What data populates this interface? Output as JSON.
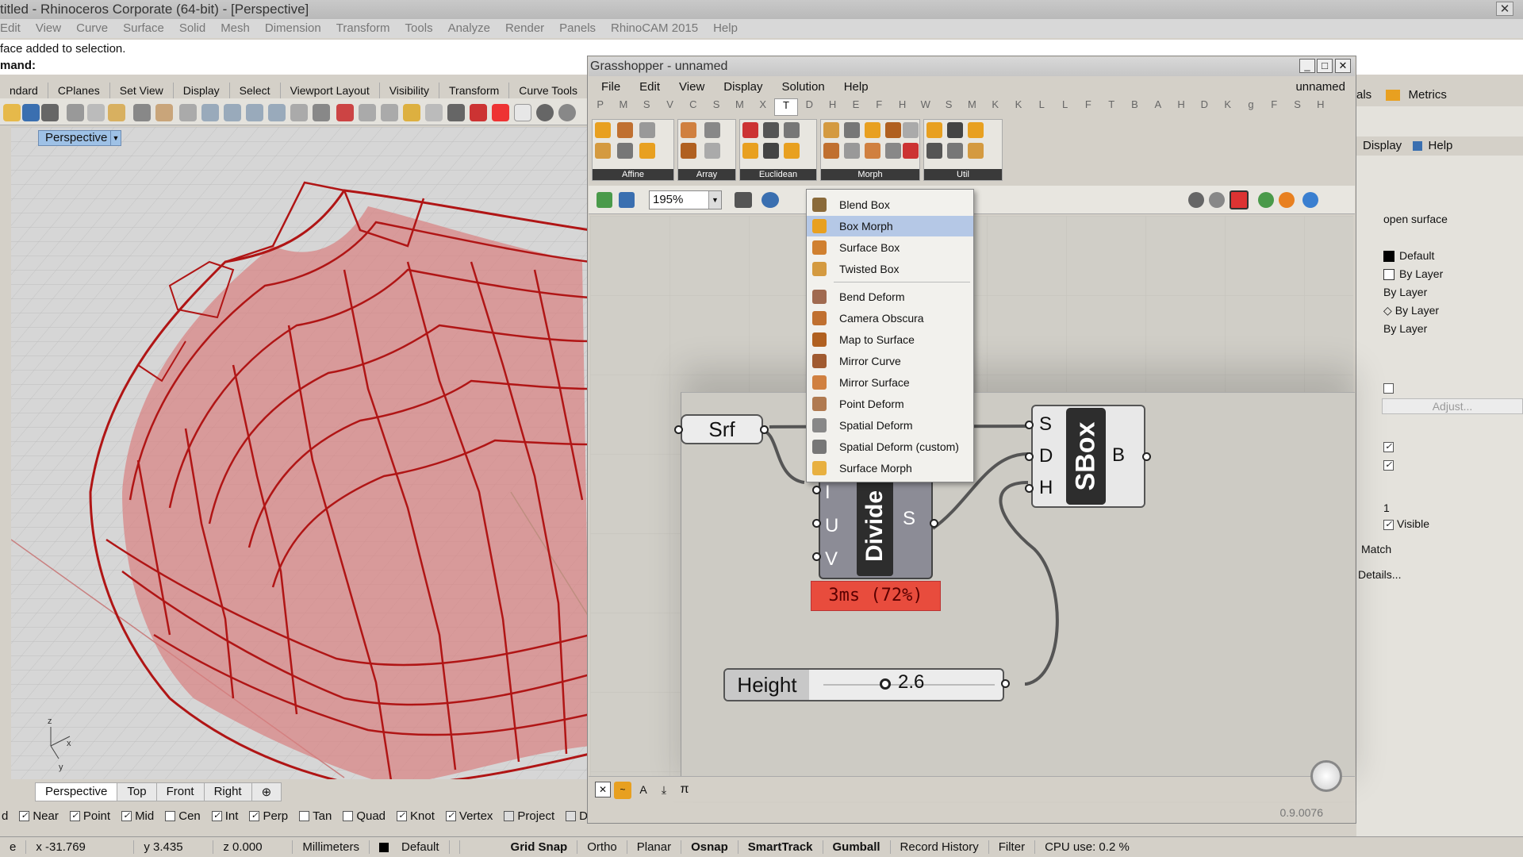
{
  "rhino": {
    "title": "titled - Rhinoceros Corporate (64-bit) - [Perspective]",
    "close": "✕",
    "menu": [
      "Edit",
      "View",
      "Curve",
      "Surface",
      "Solid",
      "Mesh",
      "Dimension",
      "Transform",
      "Tools",
      "Analyze",
      "Render",
      "Panels",
      "RhinoCAM 2015",
      "Help"
    ],
    "command_history": "face added to selection.",
    "command_prompt": "mand:",
    "toolbar_tabs": [
      "ndard",
      "CPlanes",
      "Set View",
      "Display",
      "Select",
      "Viewport Layout",
      "Visibility",
      "Transform",
      "Curve Tools"
    ],
    "viewport_label": "Perspective",
    "viewport_tabs": [
      "Perspective",
      "Top",
      "Front",
      "Right",
      "⊕"
    ],
    "axis": {
      "x": "x",
      "y": "y",
      "z": "z"
    },
    "osnap": [
      {
        "label": "d",
        "checked": null
      },
      {
        "label": "Near",
        "checked": true
      },
      {
        "label": "Point",
        "checked": true
      },
      {
        "label": "Mid",
        "checked": true
      },
      {
        "label": "Cen",
        "checked": false
      },
      {
        "label": "Int",
        "checked": true
      },
      {
        "label": "Perp",
        "checked": true
      },
      {
        "label": "Tan",
        "checked": false
      },
      {
        "label": "Quad",
        "checked": false
      },
      {
        "label": "Knot",
        "checked": true
      },
      {
        "label": "Vertex",
        "checked": true
      },
      {
        "label": "Project",
        "checked": false
      },
      {
        "label": "Disable",
        "checked": false
      }
    ],
    "status": {
      "plane": "e",
      "x": "x -31.769",
      "y": "y 3.435",
      "z": "z 0.000",
      "units": "Millimeters",
      "layer": "Default",
      "grid_snap": "Grid Snap",
      "ortho": "Ortho",
      "planar": "Planar",
      "osnap": "Osnap",
      "smarttrack": "SmartTrack",
      "gumball": "Gumball",
      "record": "Record History",
      "filter": "Filter",
      "cpu": "CPU use: 0.2 %"
    }
  },
  "props": {
    "tab_partial": "als",
    "metrics": "Metrics",
    "display_tab": "Display",
    "help_tab": "Help",
    "object_type": "open surface",
    "layer": "Default",
    "color": "By Layer",
    "linetype": "By Layer",
    "print_color": "By Layer",
    "print_width": "By Layer",
    "adjust": "Adjust...",
    "density": "1",
    "visible": "Visible",
    "match": "Match",
    "details": "Details..."
  },
  "gh": {
    "title": "Grasshopper - unnamed",
    "doc_name": "unnamed",
    "menu": [
      "File",
      "Edit",
      "View",
      "Display",
      "Solution",
      "Help"
    ],
    "categories": [
      "P",
      "M",
      "S",
      "V",
      "C",
      "S",
      "M",
      "X",
      "T",
      "D",
      "H",
      "E",
      "F",
      "H",
      "W",
      "S",
      "M",
      "K",
      "K",
      "L",
      "L",
      "F",
      "T",
      "B",
      "A",
      "H",
      "D",
      "K",
      "g",
      "F",
      "S",
      "H"
    ],
    "groups": [
      "Affine",
      "Array",
      "Euclidean",
      "Morph",
      "Util"
    ],
    "zoom": "195%",
    "menu_items": [
      "Blend Box",
      "Box Morph",
      "Surface Box",
      "Twisted Box",
      "Bend Deform",
      "Camera Obscura",
      "Map to Surface",
      "Mirror Curve",
      "Mirror Surface",
      "Point Deform",
      "Spatial Deform",
      "Spatial Deform (custom)",
      "Surface Morph"
    ],
    "highlighted": "Box Morph",
    "srf": "Srf",
    "divide": "Divide",
    "divide_inputs": [
      "I",
      "U",
      "V"
    ],
    "divide_output": "S",
    "timing": "3ms (72%)",
    "sbox": "SBox",
    "sbox_inputs": [
      "S",
      "D",
      "H"
    ],
    "sbox_output": "B",
    "slider_label": "Height",
    "slider_value": "2.6",
    "slider_fraction": 0.36,
    "version": "0.9.0076",
    "bottom_icons": [
      "✕",
      "~",
      "A",
      "⤓",
      "π"
    ],
    "colors": {
      "surface": "#d66c6c",
      "wire": "#b01515",
      "timing_bg": "#e84c3d"
    }
  }
}
